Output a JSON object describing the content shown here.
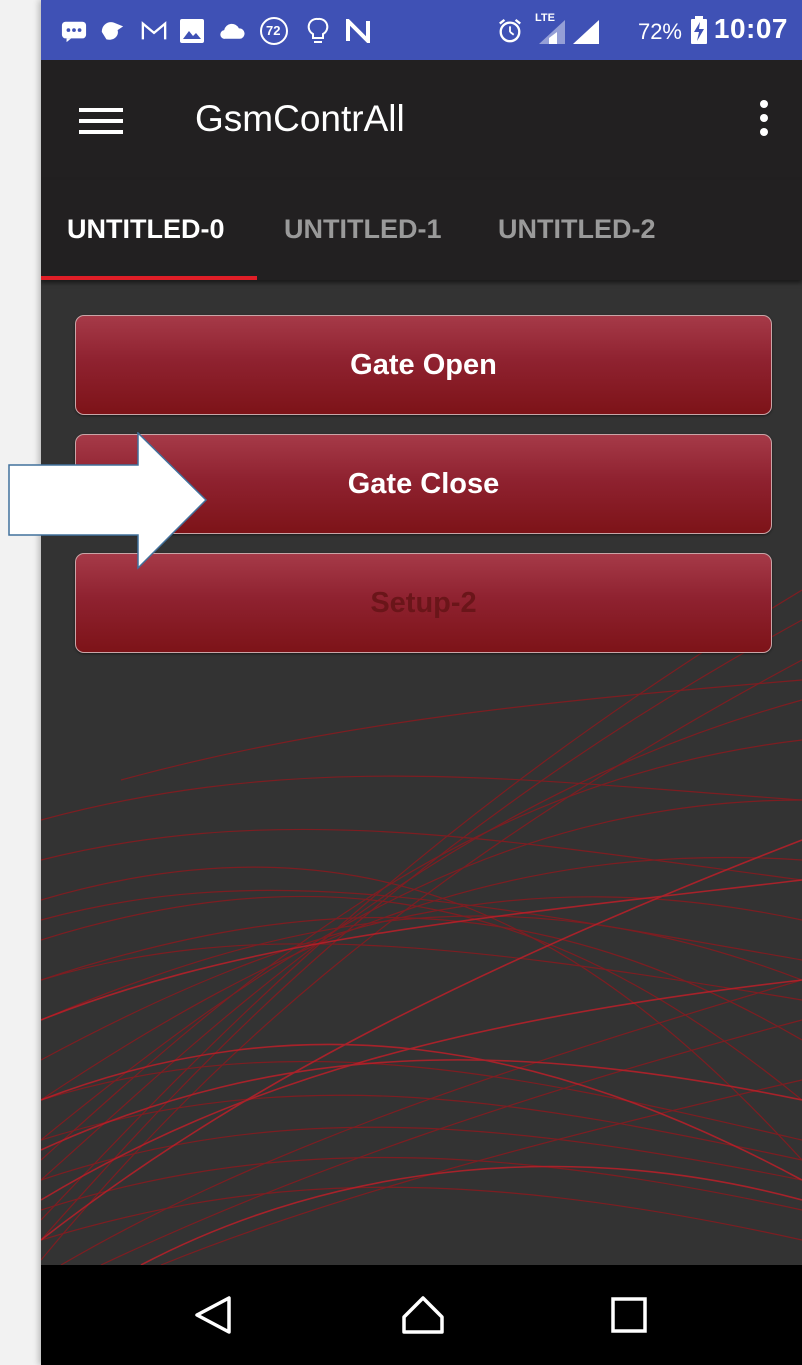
{
  "status_bar": {
    "icons": [
      "message-icon",
      "hangouts-icon",
      "gmail-icon",
      "image-icon",
      "cloud-icon",
      "temperature-badge-icon",
      "bulb-icon",
      "nfc-icon",
      "alarm-icon",
      "lte-signal-icon",
      "signal-icon",
      "battery-charging-icon"
    ],
    "temperature_badge": "72",
    "lte_label": "LTE",
    "battery_percent": "72%",
    "clock": "10:07"
  },
  "app_bar": {
    "title": "GsmContrAll",
    "menu_icon": "hamburger-menu-icon",
    "overflow_icon": "more-vert-icon"
  },
  "tabs": [
    {
      "label": "UNTITLED-0",
      "active": true
    },
    {
      "label": "UNTITLED-1",
      "active": false
    },
    {
      "label": "UNTITLED-2",
      "active": false
    }
  ],
  "buttons": [
    {
      "label": "Gate Open",
      "enabled": true
    },
    {
      "label": "Gate Close",
      "enabled": true
    },
    {
      "label": "Setup-2",
      "enabled": false
    }
  ],
  "nav_bar": {
    "icons": [
      "back-icon",
      "home-icon",
      "recents-icon"
    ]
  },
  "colors": {
    "status_bar": "#3f51b5",
    "app_bar": "#222021",
    "tab_indicator": "#e01e27",
    "background": "#333333",
    "button_top": "#a63a48",
    "button_bottom": "#7d1318",
    "callout_arrow_fill": "#ffffff",
    "callout_arrow_stroke": "#41719c"
  }
}
